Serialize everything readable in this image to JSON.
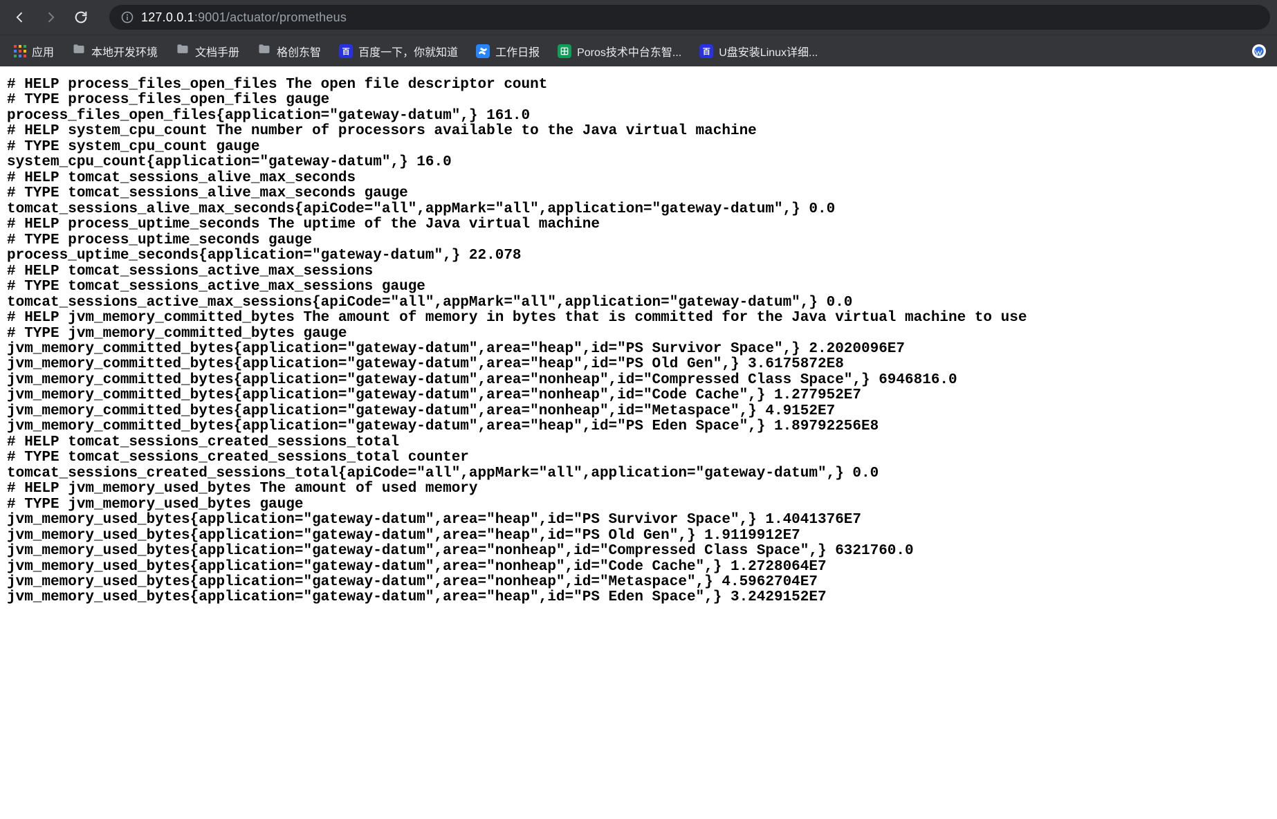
{
  "toolbar": {
    "url_host": "127.0.0.1",
    "url_rest": ":9001/actuator/prometheus"
  },
  "bookmarks": {
    "apps": "应用",
    "folder1": "本地开发环境",
    "folder2": "文档手册",
    "folder3": "格创东智",
    "baidu": "百度一下，你就知道",
    "confluence": "工作日报",
    "sheet": "Poros技术中台东智...",
    "linux": "U盘安装Linux详细...",
    "wp": ""
  },
  "metrics_lines": [
    "# HELP process_files_open_files The open file descriptor count",
    "# TYPE process_files_open_files gauge",
    "process_files_open_files{application=\"gateway-datum\",} 161.0",
    "# HELP system_cpu_count The number of processors available to the Java virtual machine",
    "# TYPE system_cpu_count gauge",
    "system_cpu_count{application=\"gateway-datum\",} 16.0",
    "# HELP tomcat_sessions_alive_max_seconds  ",
    "# TYPE tomcat_sessions_alive_max_seconds gauge",
    "tomcat_sessions_alive_max_seconds{apiCode=\"all\",appMark=\"all\",application=\"gateway-datum\",} 0.0",
    "# HELP process_uptime_seconds The uptime of the Java virtual machine",
    "# TYPE process_uptime_seconds gauge",
    "process_uptime_seconds{application=\"gateway-datum\",} 22.078",
    "# HELP tomcat_sessions_active_max_sessions  ",
    "# TYPE tomcat_sessions_active_max_sessions gauge",
    "tomcat_sessions_active_max_sessions{apiCode=\"all\",appMark=\"all\",application=\"gateway-datum\",} 0.0",
    "# HELP jvm_memory_committed_bytes The amount of memory in bytes that is committed for the Java virtual machine to use",
    "# TYPE jvm_memory_committed_bytes gauge",
    "jvm_memory_committed_bytes{application=\"gateway-datum\",area=\"heap\",id=\"PS Survivor Space\",} 2.2020096E7",
    "jvm_memory_committed_bytes{application=\"gateway-datum\",area=\"heap\",id=\"PS Old Gen\",} 3.6175872E8",
    "jvm_memory_committed_bytes{application=\"gateway-datum\",area=\"nonheap\",id=\"Compressed Class Space\",} 6946816.0",
    "jvm_memory_committed_bytes{application=\"gateway-datum\",area=\"nonheap\",id=\"Code Cache\",} 1.277952E7",
    "jvm_memory_committed_bytes{application=\"gateway-datum\",area=\"nonheap\",id=\"Metaspace\",} 4.9152E7",
    "jvm_memory_committed_bytes{application=\"gateway-datum\",area=\"heap\",id=\"PS Eden Space\",} 1.89792256E8",
    "# HELP tomcat_sessions_created_sessions_total  ",
    "# TYPE tomcat_sessions_created_sessions_total counter",
    "tomcat_sessions_created_sessions_total{apiCode=\"all\",appMark=\"all\",application=\"gateway-datum\",} 0.0",
    "# HELP jvm_memory_used_bytes The amount of used memory",
    "# TYPE jvm_memory_used_bytes gauge",
    "jvm_memory_used_bytes{application=\"gateway-datum\",area=\"heap\",id=\"PS Survivor Space\",} 1.4041376E7",
    "jvm_memory_used_bytes{application=\"gateway-datum\",area=\"heap\",id=\"PS Old Gen\",} 1.9119912E7",
    "jvm_memory_used_bytes{application=\"gateway-datum\",area=\"nonheap\",id=\"Compressed Class Space\",} 6321760.0",
    "jvm_memory_used_bytes{application=\"gateway-datum\",area=\"nonheap\",id=\"Code Cache\",} 1.2728064E7",
    "jvm_memory_used_bytes{application=\"gateway-datum\",area=\"nonheap\",id=\"Metaspace\",} 4.5962704E7",
    "jvm_memory_used_bytes{application=\"gateway-datum\",area=\"heap\",id=\"PS Eden Space\",} 3.2429152E7"
  ]
}
